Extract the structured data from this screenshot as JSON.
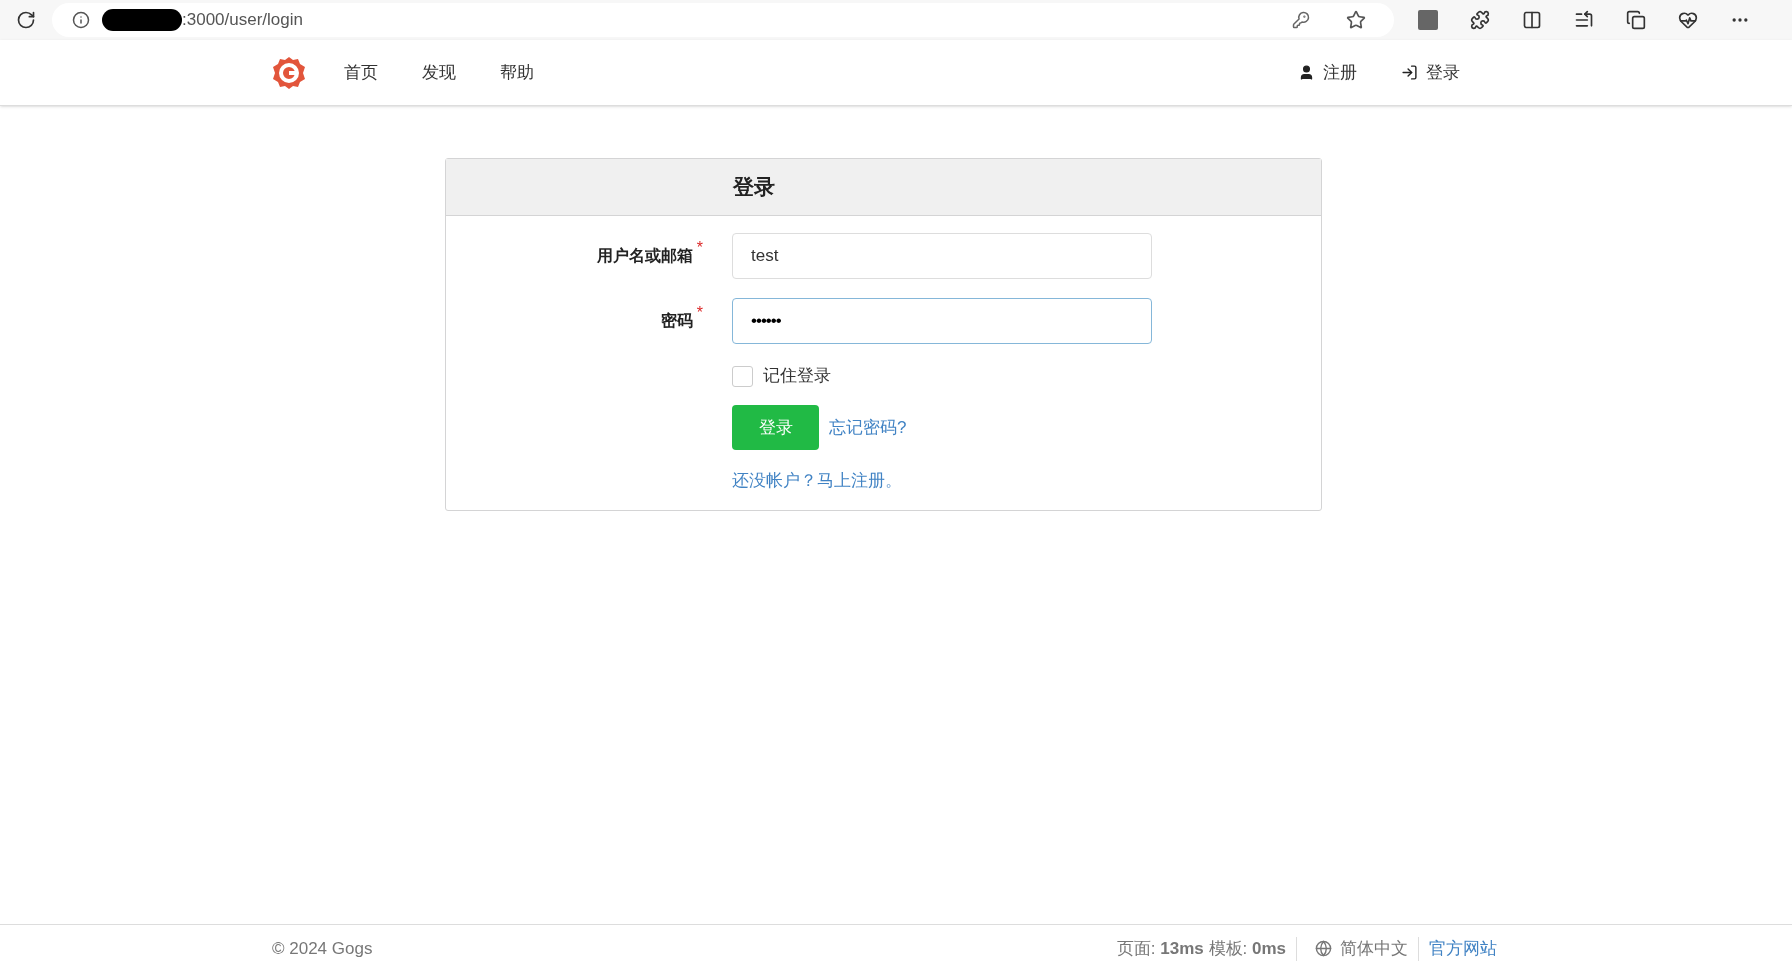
{
  "browser": {
    "url": ":3000/user/login"
  },
  "nav": {
    "items": [
      {
        "label": "首页"
      },
      {
        "label": "发现"
      },
      {
        "label": "帮助"
      }
    ],
    "right": [
      {
        "kind": "user",
        "label": "注册"
      },
      {
        "kind": "signin",
        "label": "登录"
      }
    ]
  },
  "card": {
    "title": "登录",
    "fields": [
      {
        "label": "用户名或邮箱",
        "required_mark": "*",
        "value": "test",
        "kind": "text",
        "focused": false
      },
      {
        "label": "密码",
        "required_mark": "*",
        "value": "••••••",
        "kind": "password",
        "focused": true
      }
    ],
    "remember": {
      "label": "记住登录",
      "checked": false
    },
    "submit": "登录",
    "forgot": "忘记密码?",
    "signup": "还没帐户？马上注册。"
  },
  "footer": {
    "copyright": "© 2024 Gogs",
    "page_label": "页面:",
    "page_time": "13ms",
    "template_label": "模板:",
    "template_time": "0ms",
    "language": "简体中文",
    "website": "官方网站"
  }
}
